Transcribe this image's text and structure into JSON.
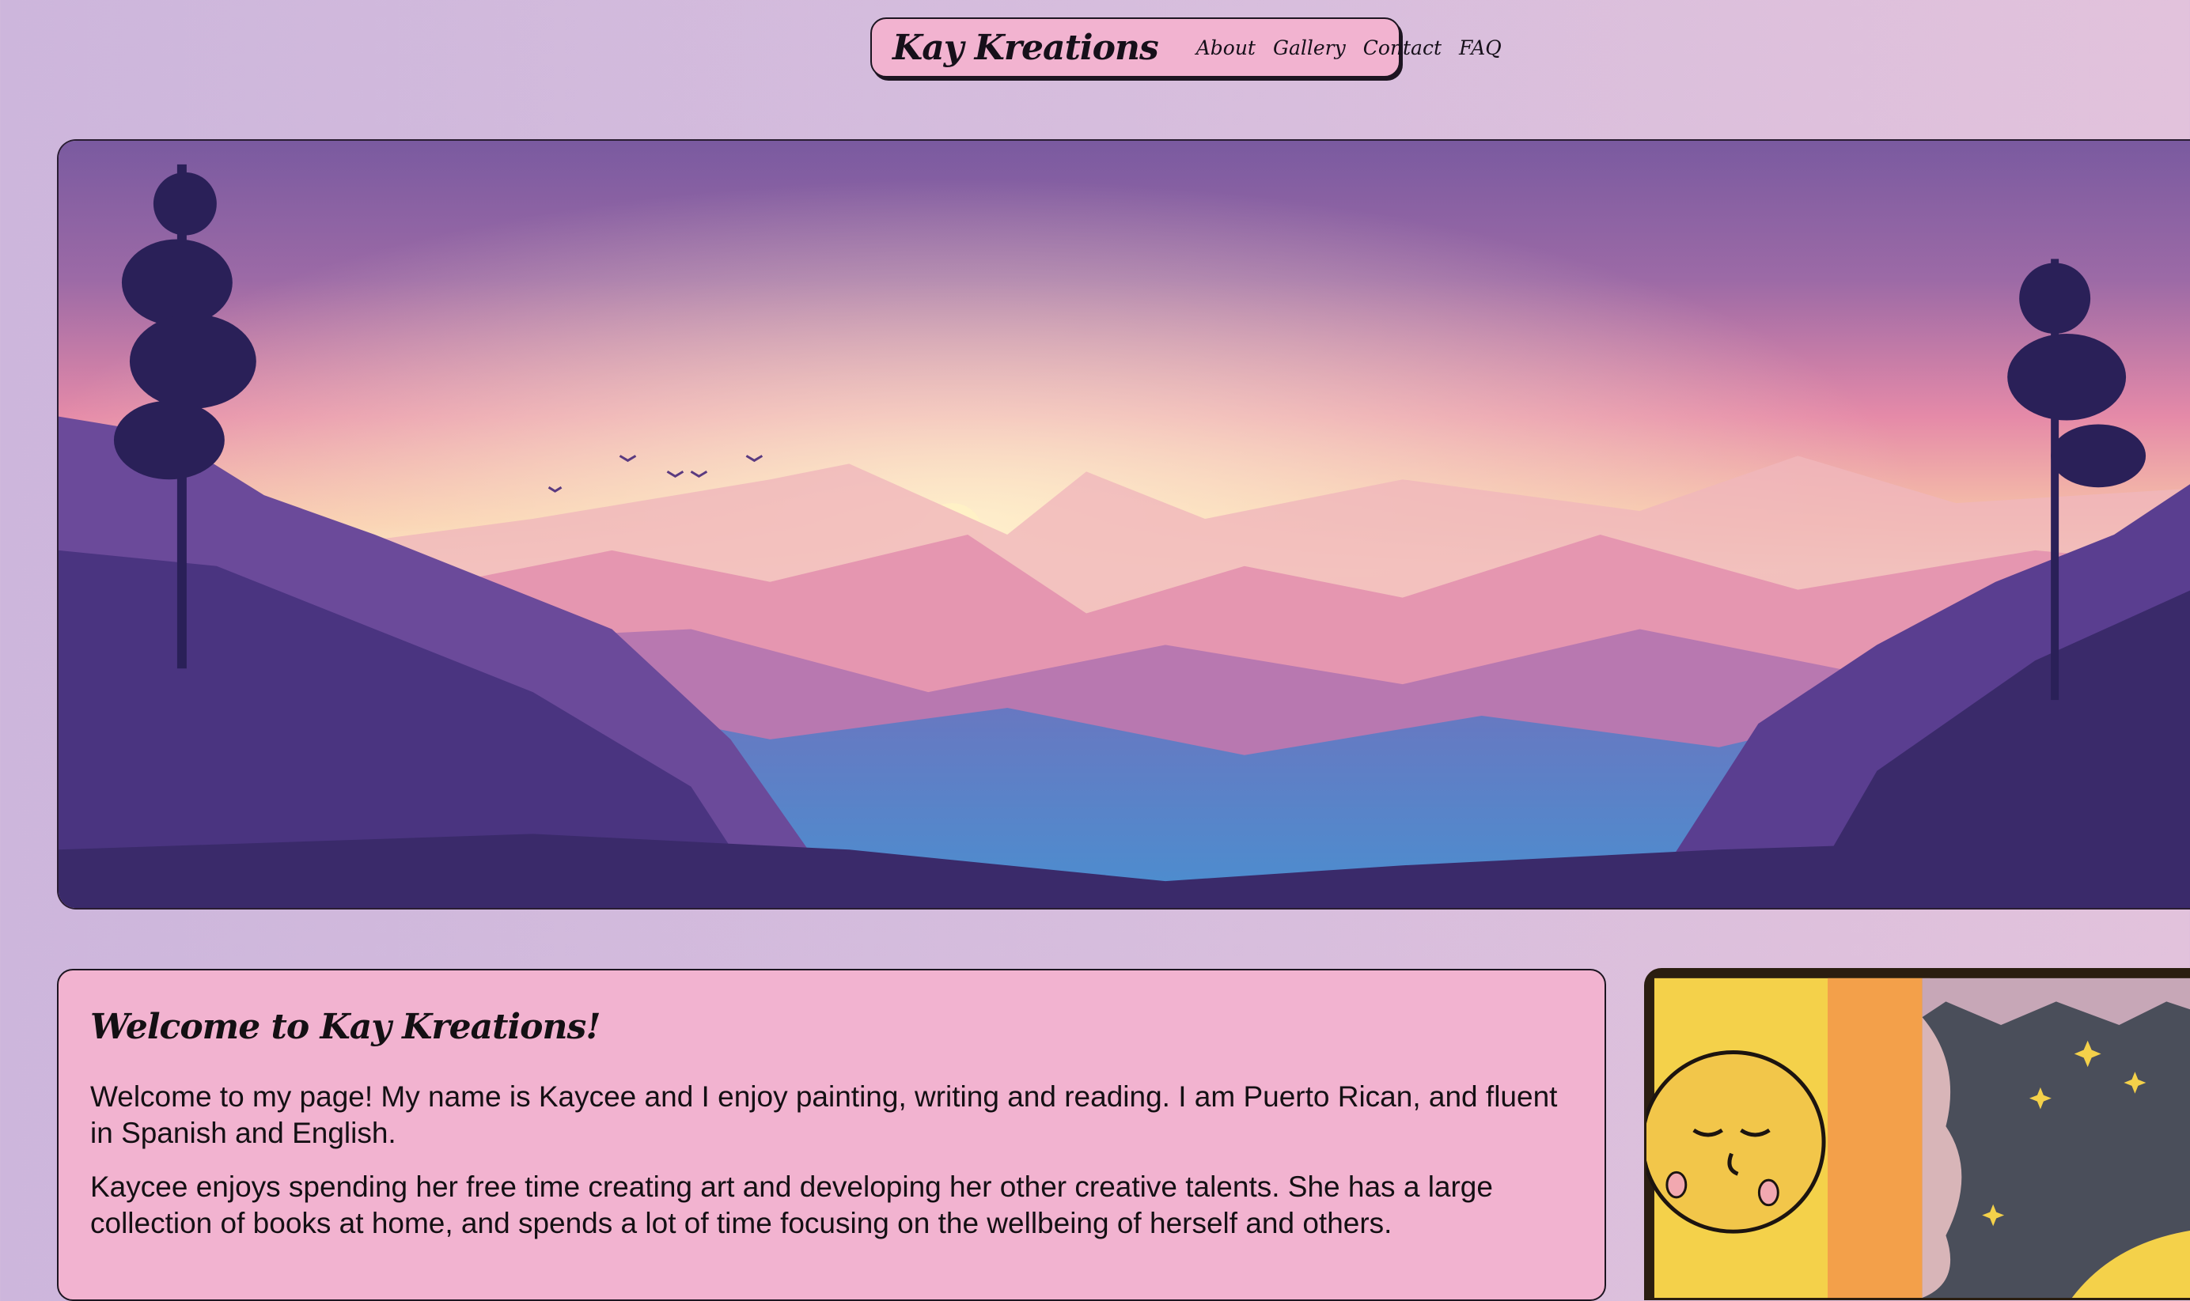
{
  "nav": {
    "brand": "Kay Kreations",
    "links": [
      {
        "label": "About"
      },
      {
        "label": "Gallery"
      },
      {
        "label": "Contact"
      },
      {
        "label": "FAQ"
      }
    ]
  },
  "hero": {
    "image_subject": "pink and purple sunset mountain landscape with pine trees and birds"
  },
  "welcome": {
    "title": "Welcome to Kay Kreations!",
    "paragraphs": [
      "Welcome to my page! My name is Kaycee and I enjoy painting, writing and reading. I am Puerto Rican, and fluent in Spanish and English.",
      "Kaycee enjoys spending her free time creating art and developing her other creative talents. She has a large collection of books at home, and spends a lot of time focusing on the wellbeing of herself and others."
    ]
  },
  "art": {
    "image_subject": "painting of a sleeping sun with clouds and a night sky with stars"
  },
  "colors": {
    "page_bg": "#d6bddd",
    "card_bg": "#f2b3d0",
    "border": "#1d1521"
  }
}
